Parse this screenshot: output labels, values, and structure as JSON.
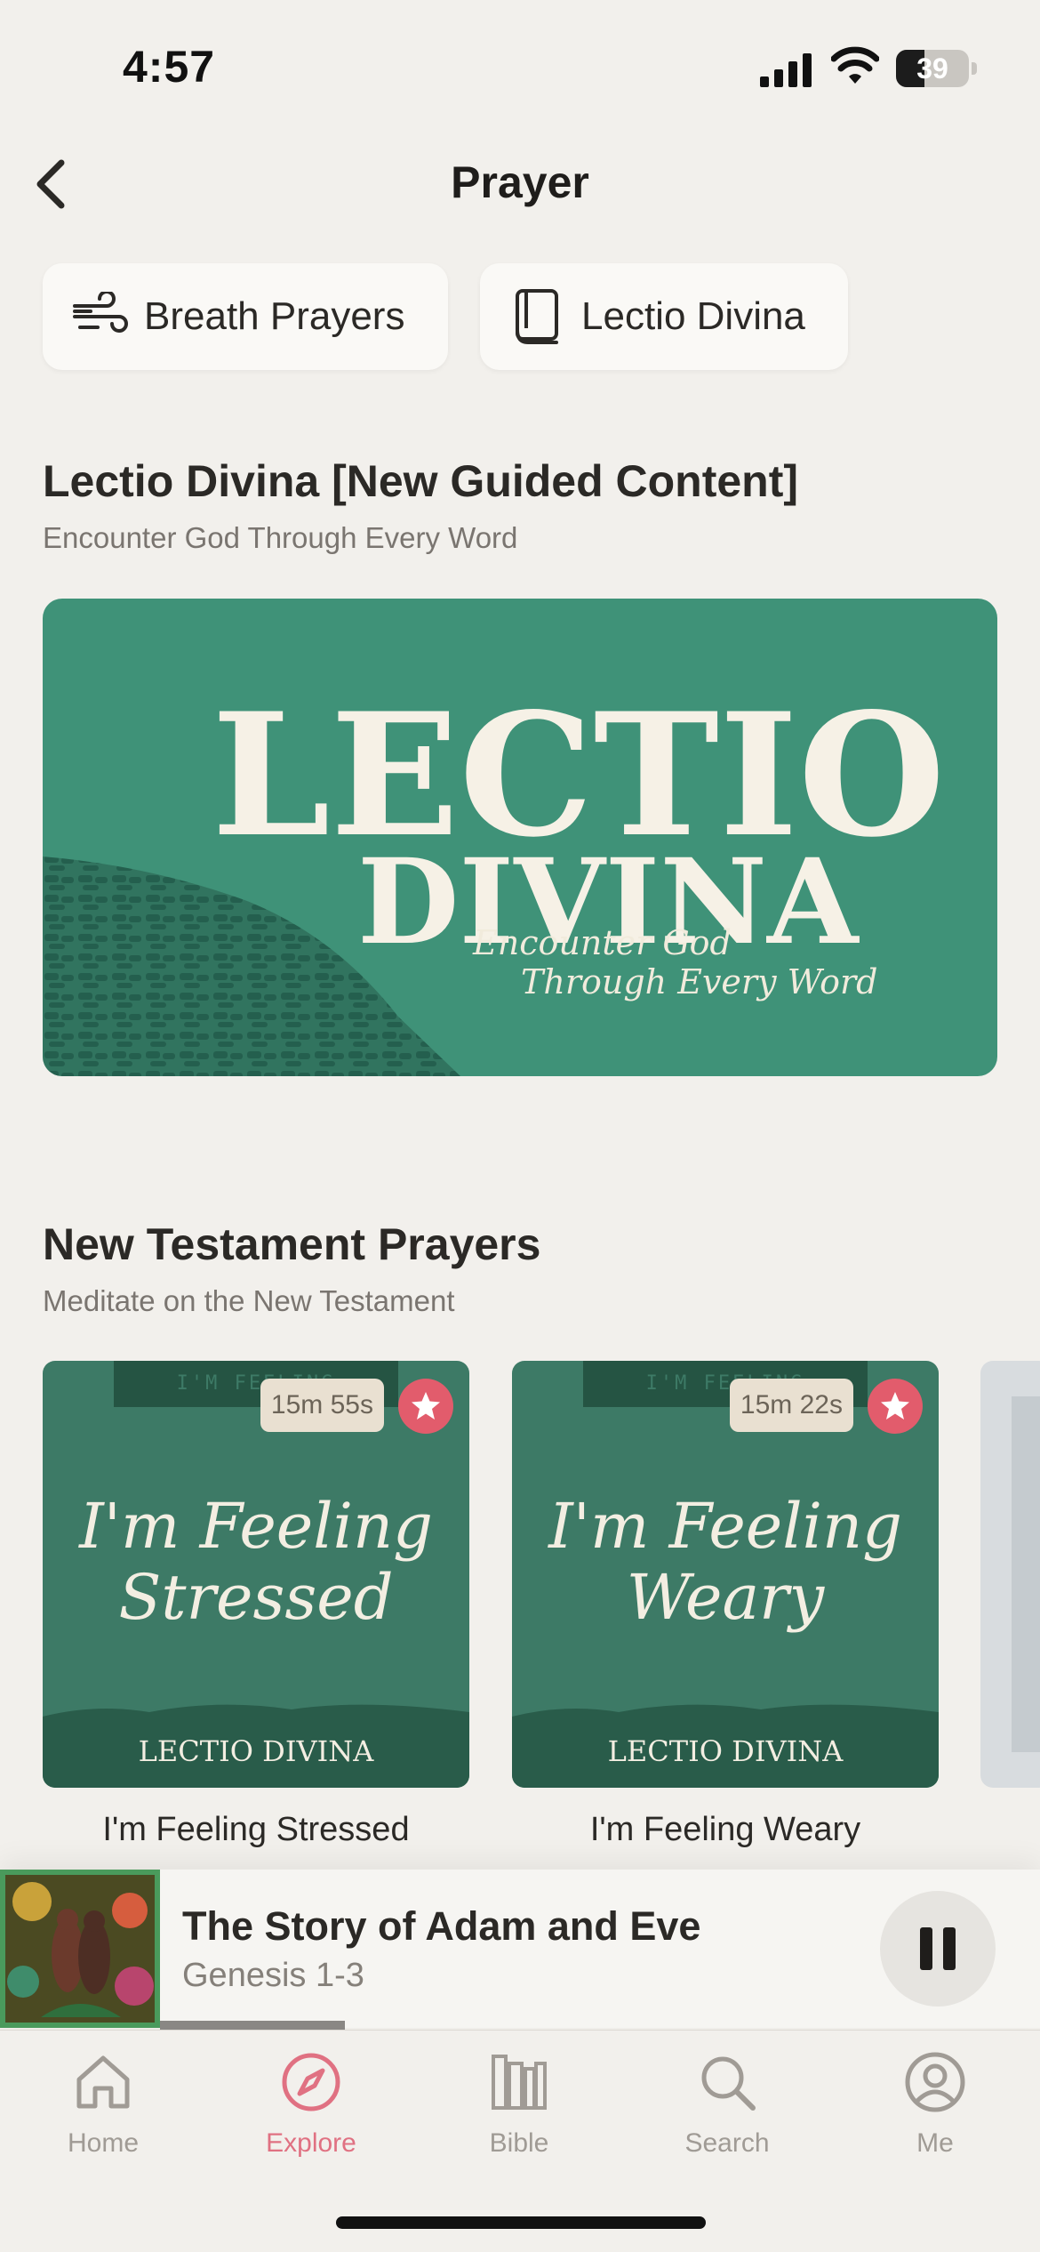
{
  "status_bar": {
    "time": "4:57",
    "battery": "39",
    "battery_level": 0.39
  },
  "header": {
    "title": "Prayer"
  },
  "chips": [
    {
      "label": "Breath Prayers",
      "icon": "wind-icon"
    },
    {
      "label": "Lectio Divina",
      "icon": "book-icon"
    }
  ],
  "section_lectio": {
    "title": "Lectio Divina [New Guided Content]",
    "subtitle": "Encounter God Through Every Word",
    "banner": {
      "line1": "LECTIO",
      "line2": "DIVINA",
      "tag1": "Encounter God",
      "tag2": "Through Every Word"
    }
  },
  "section_nt": {
    "title": "New Testament Prayers",
    "subtitle": "Meditate on the New Testament",
    "cards": [
      {
        "header": "I'M FEELING",
        "duration": "15m 55s",
        "art_line1": "I'm Feeling",
        "art_line2": "Stressed",
        "brand": "LECTIO DIVINA",
        "label": "I'm Feeling Stressed"
      },
      {
        "header": "I'M FEELING",
        "duration": "15m 22s",
        "art_line1": "I'm Feeling",
        "art_line2": "Weary",
        "brand": "LECTIO DIVINA",
        "label": "I'm Feeling Weary"
      }
    ]
  },
  "now_playing": {
    "title": "The Story of Adam and Eve",
    "subtitle": "Genesis 1-3",
    "progress": 0.21
  },
  "tabs": [
    {
      "label": "Home",
      "icon": "home-icon",
      "active": false
    },
    {
      "label": "Explore",
      "icon": "compass-icon",
      "active": true
    },
    {
      "label": "Bible",
      "icon": "books-icon",
      "active": false
    },
    {
      "label": "Search",
      "icon": "search-icon",
      "active": false
    },
    {
      "label": "Me",
      "icon": "profile-icon",
      "active": false
    }
  ],
  "colors": {
    "accent": "#e07182",
    "hero_green": "#3f9278",
    "card_green": "#3d7a66",
    "favorite": "#e25c6c",
    "background": "#f2f0ec"
  }
}
